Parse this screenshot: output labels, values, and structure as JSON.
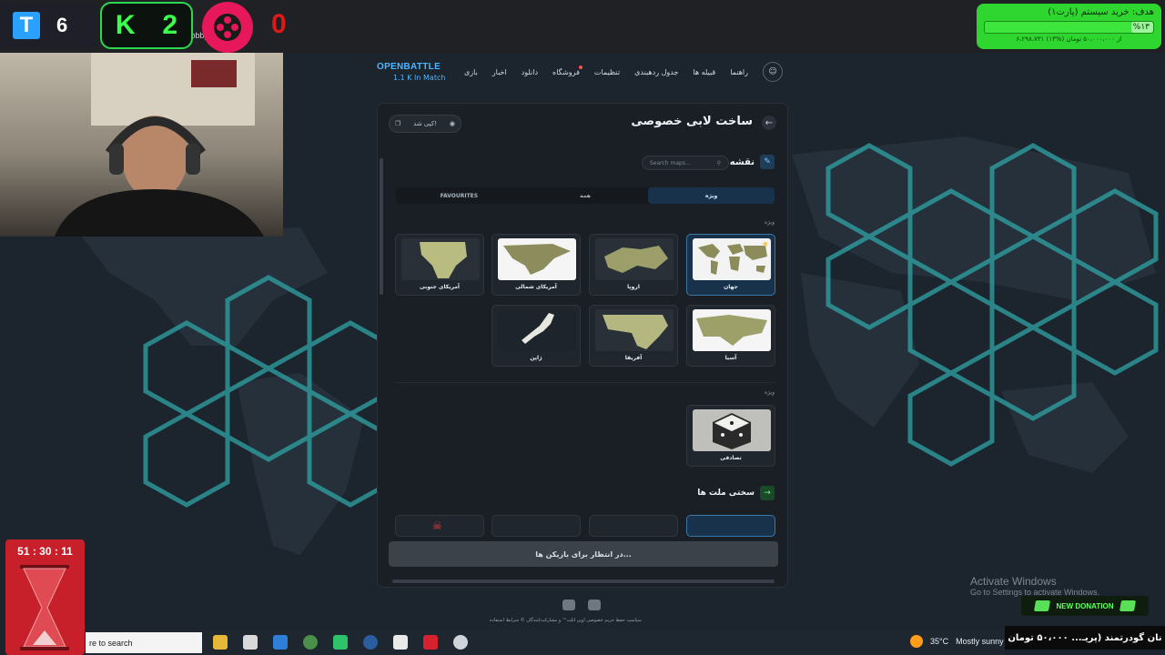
{
  "browser": {
    "url": "/lobby&s=wee88"
  },
  "stream": {
    "t_counter": "6",
    "k_counter": "2",
    "red_counter": "0",
    "timer": "51 : 30 : 11"
  },
  "goal": {
    "title": "هدف: خرید سیستم (پارت۱)",
    "percent": "%۱۳",
    "subtitle": "۶،۲۹۸،۷۳۱ از ۵۰،۰۰۰،۰۰۰ تومان (%۱۳)",
    "progress": 0.13
  },
  "site": {
    "brand": "OPENBATTLE",
    "brand_sub": "1.1 K In Match",
    "nav": [
      "بازی",
      "اخبار",
      "دانلود",
      "فروشگاه",
      "تنظیمات",
      "جدول ردهبندی",
      "قبیله ها",
      "راهنما"
    ]
  },
  "panel": {
    "title": "ساخت لابی خصوصی",
    "copy_label": "کپی شد!",
    "map_label": "نقشه",
    "search_placeholder": "Search maps...",
    "tabs": [
      "ویژه",
      "همه",
      "FAVOURITES"
    ],
    "active_tab": 0,
    "section_featured": "ویژه",
    "section_random": "ویژه",
    "maps_row1": [
      {
        "name": "جهان",
        "selected": true
      },
      {
        "name": "اروپا",
        "selected": false
      },
      {
        "name": "آمریکای شمالی",
        "selected": false
      },
      {
        "name": "آمریکای جنوبی",
        "selected": false
      }
    ],
    "maps_row2": [
      {
        "name": "آسیا"
      },
      {
        "name": "آفریقا"
      },
      {
        "name": "ژاپن"
      }
    ],
    "random_map": "تصادفی",
    "difficulty_label": "سختی ملت ها",
    "wait_button": "در انتظار برای بازیکن ها..."
  },
  "footer": {
    "links": "سیاست حفظ حریم خصوصی  اوپن اتلت™ و مشارکت‌کنندگان ©  شرایط استفاده"
  },
  "overlay": {
    "activate_title": "Activate Windows",
    "activate_sub": "Go to Settings to activate Windows.",
    "donation_label": "NEW DONATION",
    "donor_text": "نان گودرتمند (پریـ...  ۵۰،۰۰۰ تومان"
  },
  "taskbar": {
    "search_placeholder": "re to search",
    "temperature": "35°C",
    "weather": "Mostly sunny"
  },
  "colors": {
    "accent": "#4eb6ff",
    "hex_glow": "#2fa4a6",
    "goal_green": "#2fd62f",
    "timer_red": "#c8202a"
  }
}
